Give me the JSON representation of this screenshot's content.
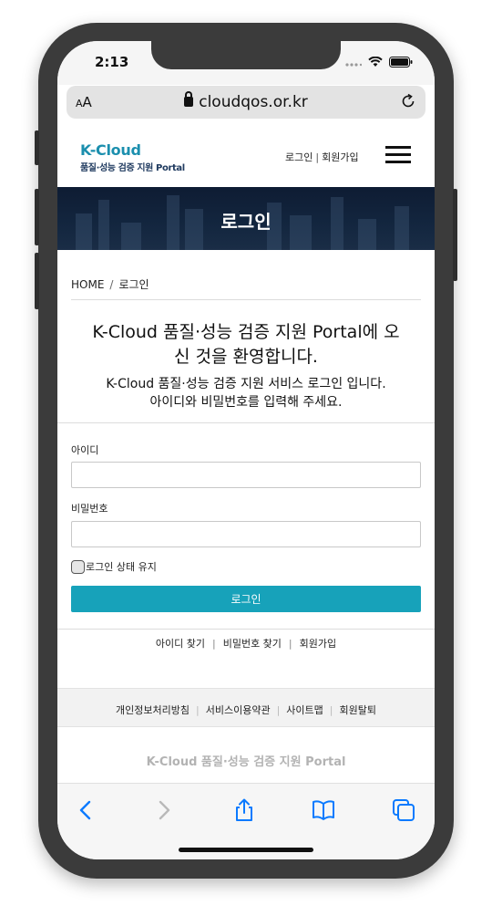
{
  "status": {
    "time": "2:13"
  },
  "browser": {
    "aa_small": "A",
    "aa_big": "A",
    "url": "cloudqos.or.kr"
  },
  "header": {
    "logo_main": "K-Cloud",
    "logo_sub": "품질·성능 검증 지원 Portal",
    "login_link": "로그인",
    "signup_link": "회원가입"
  },
  "banner": {
    "title": "로그인"
  },
  "breadcrumb": {
    "home": "HOME",
    "current": "로그인"
  },
  "welcome": {
    "heading_line1": "K-Cloud 품질·성능 검증 지원 Portal에 오",
    "heading_line2": "신 것을 환영합니다.",
    "desc_line1": "K-Cloud 품질·성능 검증 지원 서비스 로그인 입니다.",
    "desc_line2": "아이디와 비밀번호를 입력해 주세요."
  },
  "form": {
    "id_label": "아이디",
    "id_value": "",
    "password_label": "비밀번호",
    "password_value": "",
    "remember_label": "로그인 상태 유지",
    "remember_checked": false,
    "submit_label": "로그인"
  },
  "links": {
    "find_id": "아이디 찾기",
    "find_password": "비밀번호 찾기",
    "signup": "회원가입"
  },
  "footer": {
    "privacy": "개인정보처리방침",
    "terms": "서비스이용약관",
    "sitemap": "사이트맵",
    "withdraw": "회원탈퇴",
    "brand_a": "K-Cloud",
    "brand_b": " 품질·성능 검증 지원 Portal"
  },
  "colors": {
    "accent": "#17a2ba",
    "ios_blue": "#0a7aff",
    "banner": "#13263f"
  }
}
